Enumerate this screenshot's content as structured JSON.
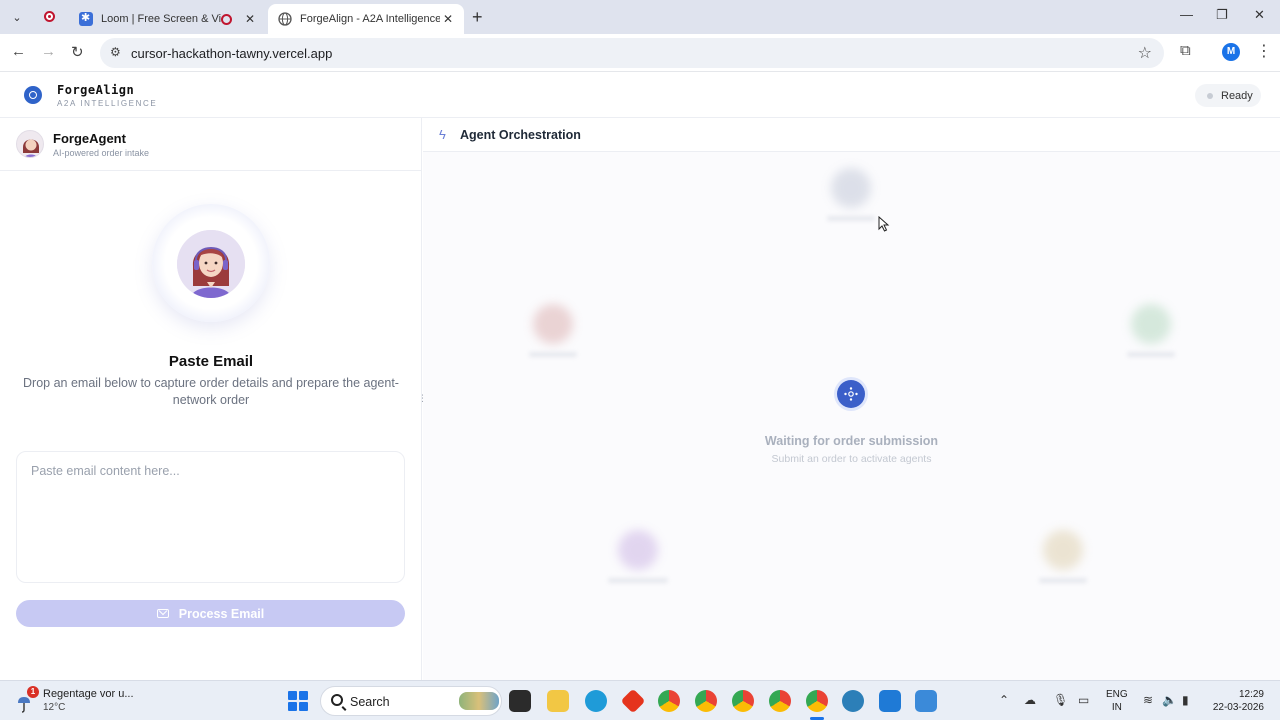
{
  "browser": {
    "tabs": [
      {
        "title": "Loom | Free Screen & Video"
      },
      {
        "title": "ForgeAlign - A2A Intelligence"
      }
    ],
    "url": "cursor-hackathon-tawny.vercel.app",
    "profile_initial": "M"
  },
  "app": {
    "brand": "ForgeAlign",
    "brand_sub": "A2A INTELLIGENCE",
    "status": "Ready"
  },
  "left_panel": {
    "agent_name": "ForgeAgent",
    "agent_subtitle": "AI-powered order intake",
    "title": "Paste Email",
    "description": "Drop an email below to capture order details and prepare the agent-network order",
    "email_placeholder": "Paste email content here...",
    "process_button": "Process Email"
  },
  "right_panel": {
    "title": "Agent Orchestration",
    "waiting_title": "Waiting for order submission",
    "waiting_subtitle": "Submit an order to activate agents"
  },
  "taskbar": {
    "weather_title": "Regentage vor u...",
    "weather_temp": "12°C",
    "weather_badge": "1",
    "search_label": "Search",
    "lang_line1": "ENG",
    "lang_line2": "IN",
    "time": "12:29",
    "date": "22-03-2026"
  },
  "colors": {
    "accent": "#3b5fc9",
    "button_disabled": "#c7c9f3",
    "background_soft": "#fbfbfd"
  }
}
